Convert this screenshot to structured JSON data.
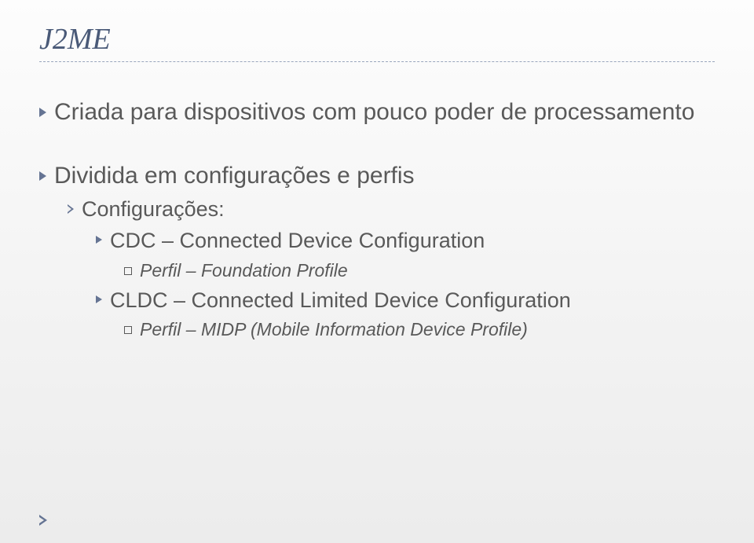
{
  "title": "J2ME",
  "bullets": {
    "b1": "Criada para dispositivos com pouco poder de processamento",
    "b2": "Dividida em configurações e perfis",
    "b2_1": "Configurações:",
    "b2_1_1": "CDC – Connected Device Configuration",
    "b2_1_1_p": "Perfil – Foundation Profile",
    "b2_1_2": "CLDC – Connected Limited Device Configuration",
    "b2_1_2_p": "Perfil – MIDP (Mobile Information Device Profile)"
  }
}
